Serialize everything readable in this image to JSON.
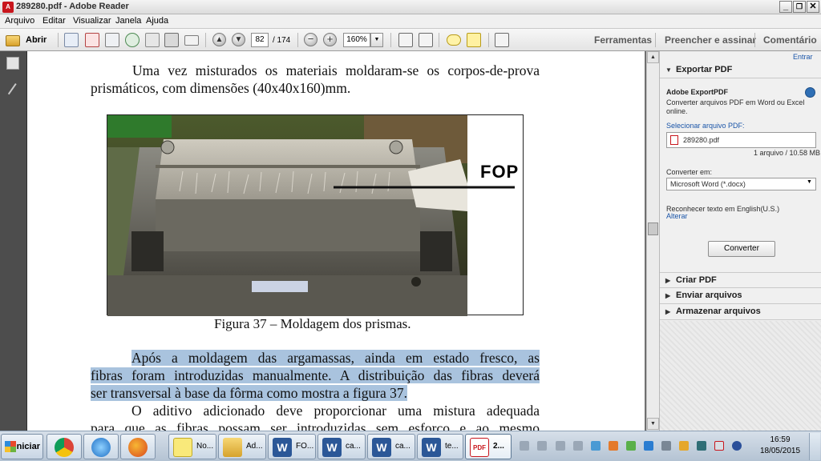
{
  "window": {
    "title": "289280.pdf - Adobe Reader",
    "app_icon_text": "A",
    "controls": [
      "_",
      "❐",
      "✕"
    ]
  },
  "menu": [
    "Arquivo",
    "Editar",
    "Visualizar",
    "Janela",
    "Ajuda"
  ],
  "toolbar": {
    "open_label": "Abrir",
    "page_current": "82",
    "page_total": "/ 174",
    "zoom": "160%",
    "links": [
      "Ferramentas",
      "Preencher e assinar",
      "Comentário"
    ]
  },
  "document": {
    "para1": "Uma vez misturados os materiais moldaram-se os corpos-de-prova prismáticos, com dimensões (40x40x160)mm.",
    "figure_label": "FOP",
    "caption": "Figura 37 – Moldagem dos prismas.",
    "para2_line1": "Após a moldagem das argamassas, ainda em estado fresco, as",
    "para2_line2": "fibras foram introduzidas manualmente. A distribuição das fibras deverá",
    "para2_line3": "ser transversal à base da fôrma como mostra a figura 37.",
    "para3_line1": "O aditivo adicionado deve proporcionar uma mistura adequada",
    "para3_line2": "para que as fibras possam ser introduzidas sem esforço e ao mesmo"
  },
  "right_panel": {
    "signin": "Entrar",
    "export_header": "Exportar PDF",
    "service_title": "Adobe ExportPDF",
    "service_desc": "Converter arquivos PDF em Word ou Excel online.",
    "select_label": "Selecionar arquivo PDF:",
    "file_name": "289280.pdf",
    "file_info": "1 arquivo / 10.58 MB",
    "convert_to_label": "Converter em:",
    "convert_format": "Microsoft Word (*.docx)",
    "ocr_text": "Reconhecer texto em English(U.S.)",
    "change_link": "Alterar",
    "convert_button": "Converter",
    "sections": [
      "Criar PDF",
      "Enviar arquivos",
      "Armazenar arquivos"
    ]
  },
  "taskbar": {
    "start_label": "Iniciar",
    "buttons": [
      "",
      "",
      "",
      "No...",
      "Ad...",
      "FO...",
      "ca...",
      "ca...",
      "te...",
      "2..."
    ],
    "clock_time": "16:59",
    "clock_date": "18/05/2015"
  },
  "colors": {
    "highlight": "#a9c3de",
    "acrobat_red": "#c8161d",
    "link_gray": "#5a5a5a",
    "link_blue": "#1a55a8"
  }
}
